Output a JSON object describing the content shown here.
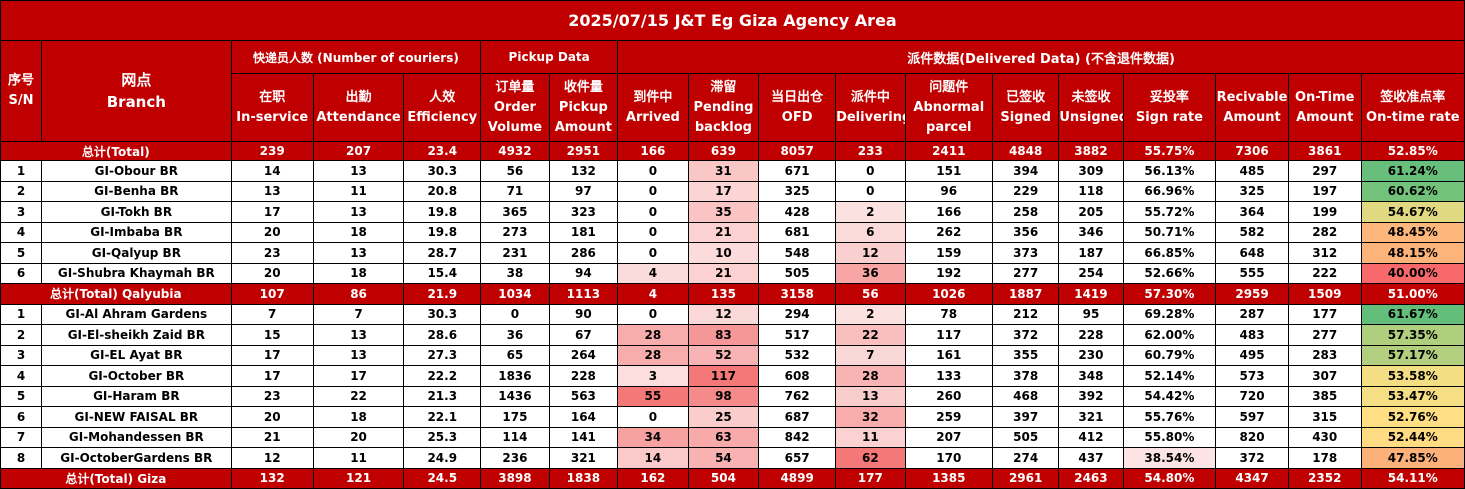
{
  "title": "2025/07/15 J&T Eg  Giza Agency Area",
  "header": {
    "sn_cn": "序号",
    "sn_en": "S/N",
    "branch_cn": "网点",
    "branch_en": "Branch",
    "group_couriers": "快递员人数 (Number of couriers)",
    "group_pickup": "Pickup Data",
    "group_delivered": "派件数据(Delivered Data) (不含退件数据)",
    "columns": [
      {
        "cn": "在职",
        "en": "In-service"
      },
      {
        "cn": "出勤",
        "en": "Attendance"
      },
      {
        "cn": "人效",
        "en": "Efficiency"
      },
      {
        "cn": "订单量",
        "en": "Order Volume"
      },
      {
        "cn": "收件量",
        "en": "Pickup Amount"
      },
      {
        "cn": "到件中",
        "en": "Arrived"
      },
      {
        "cn": "滞留",
        "en": "Pending backlog"
      },
      {
        "cn": "当日出仓",
        "en": "OFD"
      },
      {
        "cn": "派件中",
        "en": "Delivering"
      },
      {
        "cn": "问题件",
        "en": "Abnormal parcel"
      },
      {
        "cn": "已签收",
        "en": "Signed"
      },
      {
        "cn": "未签收",
        "en": "Unsigned"
      },
      {
        "cn": "妥投率",
        "en": "Sign rate"
      },
      {
        "cn": "",
        "en": "Recivable Amount"
      },
      {
        "cn": "",
        "en": "On-Time Amount"
      },
      {
        "cn": "签收准点率",
        "en": "On-time rate"
      }
    ]
  },
  "rows": [
    {
      "type": "total",
      "label": "总计(Total)",
      "values": [
        "239",
        "207",
        "23.4",
        "4932",
        "2951",
        "166",
        "639",
        "8057",
        "233",
        "2411",
        "4848",
        "3882",
        "55.75%",
        "7306",
        "3861",
        "52.85%"
      ]
    },
    {
      "type": "data",
      "sn": "1",
      "branch": "GI-Obour BR",
      "values": [
        "14",
        "13",
        "30.3",
        "56",
        "132",
        "0",
        "31",
        "671",
        "0",
        "151",
        "394",
        "309",
        "56.13%",
        "485",
        "297",
        "61.24%"
      ]
    },
    {
      "type": "data",
      "sn": "2",
      "branch": "GI-Benha BR",
      "values": [
        "13",
        "11",
        "20.8",
        "71",
        "97",
        "0",
        "17",
        "325",
        "0",
        "96",
        "229",
        "118",
        "66.96%",
        "325",
        "197",
        "60.62%"
      ]
    },
    {
      "type": "data",
      "sn": "3",
      "branch": "GI-Tokh BR",
      "values": [
        "17",
        "13",
        "19.8",
        "365",
        "323",
        "0",
        "35",
        "428",
        "2",
        "166",
        "258",
        "205",
        "55.72%",
        "364",
        "199",
        "54.67%"
      ]
    },
    {
      "type": "data",
      "sn": "4",
      "branch": "GI-Imbaba BR",
      "values": [
        "20",
        "18",
        "19.8",
        "273",
        "181",
        "0",
        "21",
        "681",
        "6",
        "262",
        "356",
        "346",
        "50.71%",
        "582",
        "282",
        "48.45%"
      ]
    },
    {
      "type": "data",
      "sn": "5",
      "branch": "GI-Qalyup BR",
      "values": [
        "23",
        "13",
        "28.7",
        "231",
        "286",
        "0",
        "10",
        "548",
        "12",
        "159",
        "373",
        "187",
        "66.85%",
        "648",
        "312",
        "48.15%"
      ]
    },
    {
      "type": "data",
      "sn": "6",
      "branch": "GI-Shubra Khaymah BR",
      "values": [
        "20",
        "18",
        "15.4",
        "38",
        "94",
        "4",
        "21",
        "505",
        "36",
        "192",
        "277",
        "254",
        "52.66%",
        "555",
        "222",
        "40.00%"
      ]
    },
    {
      "type": "total",
      "label": "总计(Total) Qalyubia",
      "values": [
        "107",
        "86",
        "21.9",
        "1034",
        "1113",
        "4",
        "135",
        "3158",
        "56",
        "1026",
        "1887",
        "1419",
        "57.30%",
        "2959",
        "1509",
        "51.00%"
      ]
    },
    {
      "type": "data",
      "sn": "1",
      "branch": "GI-Al Ahram Gardens",
      "values": [
        "7",
        "7",
        "30.3",
        "0",
        "90",
        "0",
        "12",
        "294",
        "2",
        "78",
        "212",
        "95",
        "69.28%",
        "287",
        "177",
        "61.67%"
      ]
    },
    {
      "type": "data",
      "sn": "2",
      "branch": "GI-El-sheikh Zaid BR",
      "values": [
        "15",
        "13",
        "28.6",
        "36",
        "67",
        "28",
        "83",
        "517",
        "22",
        "117",
        "372",
        "228",
        "62.00%",
        "483",
        "277",
        "57.35%"
      ]
    },
    {
      "type": "data",
      "sn": "3",
      "branch": "GI-EL Ayat BR",
      "values": [
        "17",
        "13",
        "27.3",
        "65",
        "264",
        "28",
        "52",
        "532",
        "7",
        "161",
        "355",
        "230",
        "60.79%",
        "495",
        "283",
        "57.17%"
      ]
    },
    {
      "type": "data",
      "sn": "4",
      "branch": "GI-October BR",
      "values": [
        "17",
        "17",
        "22.2",
        "1836",
        "228",
        "3",
        "117",
        "608",
        "28",
        "133",
        "378",
        "348",
        "52.14%",
        "573",
        "307",
        "53.58%"
      ]
    },
    {
      "type": "data",
      "sn": "5",
      "branch": "GI-Haram BR",
      "values": [
        "23",
        "22",
        "21.3",
        "1436",
        "563",
        "55",
        "98",
        "762",
        "13",
        "260",
        "468",
        "392",
        "54.42%",
        "720",
        "385",
        "53.47%"
      ]
    },
    {
      "type": "data",
      "sn": "6",
      "branch": "GI-NEW FAISAL BR",
      "values": [
        "20",
        "18",
        "22.1",
        "175",
        "164",
        "0",
        "25",
        "687",
        "32",
        "259",
        "397",
        "321",
        "55.76%",
        "597",
        "315",
        "52.76%"
      ]
    },
    {
      "type": "data",
      "sn": "7",
      "branch": "GI-Mohandessen BR",
      "values": [
        "21",
        "20",
        "25.3",
        "114",
        "141",
        "34",
        "63",
        "842",
        "11",
        "207",
        "505",
        "412",
        "55.80%",
        "820",
        "430",
        "52.44%"
      ]
    },
    {
      "type": "data",
      "sn": "8",
      "branch": "GI-OctoberGardens BR",
      "values": [
        "12",
        "11",
        "24.9",
        "236",
        "321",
        "14",
        "54",
        "657",
        "62",
        "170",
        "274",
        "437",
        "38.54%",
        "372",
        "178",
        "47.85%"
      ]
    },
    {
      "type": "total",
      "label": "总计(Total) Giza",
      "values": [
        "132",
        "121",
        "24.5",
        "3898",
        "1838",
        "162",
        "504",
        "4899",
        "177",
        "1385",
        "2961",
        "2463",
        "54.80%",
        "4347",
        "2352",
        "54.11%"
      ]
    }
  ],
  "colors": {
    "header_red": "#c00000",
    "header_text": "#ffffff",
    "heat_light": "#fce4e4",
    "heat_strong": "#f47878",
    "rate_good": "#63be7b",
    "rate_mid": "#ffe084",
    "rate_bad": "#f8696b"
  }
}
